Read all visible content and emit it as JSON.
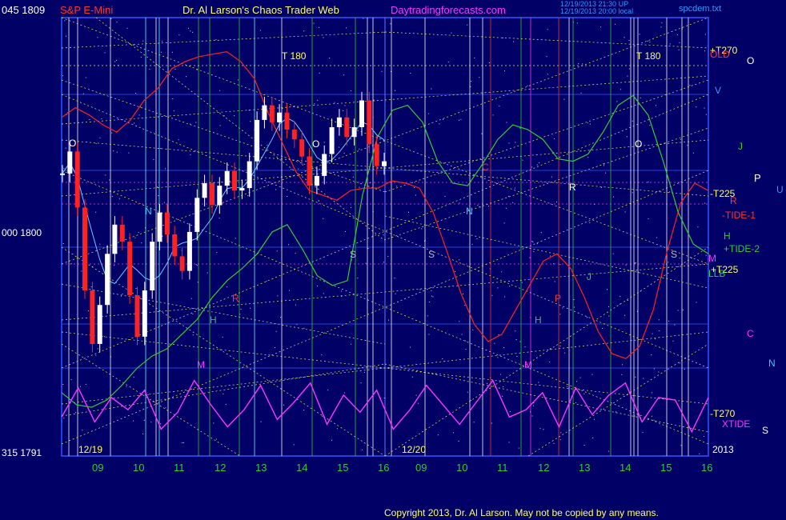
{
  "header": {
    "corner_values": "045  1809",
    "symbol": "S&P E-Mini",
    "title": "Dr. Al Larson's Chaos Trader Web",
    "website": "Daytradingforecasts.com",
    "timestamp_1": "12/19/2013 21:30 UP",
    "timestamp_2": "12/19/2013 20:00 local",
    "filename": "spcdem.txt"
  },
  "y_axis_labels": {
    "mid": "000  1800",
    "bottom": "315  1791"
  },
  "copyright": "Copyright 2013, Dr. Al Larson. May not be copied by any means.",
  "chart_data": {
    "type": "line",
    "title": "S&P E-Mini",
    "ylim": [
      1791,
      1809
    ],
    "x_ticks": [
      "09",
      "10",
      "11",
      "12",
      "13",
      "14",
      "15",
      "16",
      "09",
      "10",
      "11",
      "12",
      "13",
      "14",
      "15",
      "16"
    ],
    "date_labels": [
      "12/19",
      "12/20"
    ],
    "year_label": "2013",
    "price_series": {
      "name": "S&P E-Mini",
      "values": [
        1802.6,
        1803.5,
        1801.2,
        1797.8,
        1795.6,
        1797.2,
        1799.3,
        1800.5,
        1799.8,
        1797.6,
        1795.9,
        1797.8,
        1799.8,
        1801.0,
        1800.1,
        1799.2,
        1798.6,
        1800.2,
        1801.6,
        1802.2,
        1801.3,
        1802.1,
        1802.7,
        1801.9,
        1802.0,
        1803.1,
        1804.8,
        1805.4,
        1804.7,
        1805.1,
        1804.4,
        1804.0,
        1803.3,
        1802.1,
        1802.5,
        1803.4,
        1804.5,
        1804.9,
        1804.1,
        1804.5,
        1805.6,
        1803.8,
        1802.9,
        1803.1
      ]
    },
    "series": [
      {
        "name": "TIDE-1",
        "color": "#ff2020",
        "values": [
          1804.9,
          1805.3,
          1805.0,
          1804.6,
          1804.3,
          1804.8,
          1805.6,
          1806.1,
          1806.9,
          1807.2,
          1807.4,
          1807.5,
          1807.6,
          1807.2,
          1806.5,
          1805.1,
          1803.9,
          1802.7,
          1801.9,
          1801.7,
          1801.5,
          1801.9,
          1802.0,
          1802.0,
          1802.3,
          1802.2,
          1802.0,
          1801.0,
          1799.4,
          1797.7,
          1796.4,
          1795.7,
          1796.0,
          1797.0,
          1798.0,
          1799.0,
          1799.3,
          1798.7,
          1797.5,
          1796.1,
          1795.2,
          1795.0,
          1795.5,
          1797.0,
          1799.4,
          1801.4,
          1802.2,
          1801.9
        ]
      },
      {
        "name": "TIDE-2",
        "color": "#33cc33",
        "values": [
          1793.6,
          1793.1,
          1793.0,
          1793.3,
          1793.9,
          1794.6,
          1795.1,
          1795.4,
          1796.0,
          1796.6,
          1797.5,
          1798.2,
          1798.7,
          1799.3,
          1800.2,
          1800.5,
          1799.5,
          1798.4,
          1798.0,
          1798.2,
          1801.7,
          1804.1,
          1805.2,
          1805.4,
          1804.7,
          1803.1,
          1802.2,
          1802.1,
          1803.0,
          1804.0,
          1804.6,
          1804.4,
          1804.0,
          1803.2,
          1803.1,
          1803.4,
          1804.3,
          1805.4,
          1805.8,
          1805.0,
          1803.1,
          1801.0,
          1799.7,
          1799.3
        ]
      },
      {
        "name": "XTIDE",
        "color": "#ff33ff",
        "values": [
          1792.6,
          1793.8,
          1792.4,
          1793.4,
          1792.9,
          1793.7,
          1792.1,
          1792.8,
          1794.1,
          1793.1,
          1792.2,
          1792.9,
          1793.9,
          1792.5,
          1793.2,
          1794.0,
          1792.3,
          1793.5,
          1792.8,
          1793.7,
          1792.1,
          1792.9,
          1793.9,
          1793.1,
          1792.3,
          1793.2,
          1794.1,
          1792.6,
          1792.9,
          1793.6,
          1792.2,
          1793.8,
          1792.7,
          1793.5,
          1794.0,
          1792.4,
          1793.4,
          1793.3,
          1792.0,
          1793.4
        ]
      }
    ],
    "right_labels": [
      {
        "text": "+T270",
        "color": "#ffff66"
      },
      {
        "text": "OLD",
        "color": "#ff3333"
      },
      {
        "text": "O",
        "color": "#ffffff"
      },
      {
        "text": "V",
        "color": "#3399ff"
      },
      {
        "text": "J",
        "color": "#33cc33"
      },
      {
        "text": "P",
        "color": "#ffffff"
      },
      {
        "text": "U",
        "color": "#3399ff"
      },
      {
        "text": "-T225",
        "color": "#ffff66"
      },
      {
        "text": "R",
        "color": "#ff3333"
      },
      {
        "text": "-TIDE-1",
        "color": "#ff3333"
      },
      {
        "text": "H",
        "color": "#33cc33"
      },
      {
        "text": "+TIDE-2",
        "color": "#33cc33"
      },
      {
        "text": "M",
        "color": "#ff33ff"
      },
      {
        "text": "+T225",
        "color": "#ffff66"
      },
      {
        "text": "LLB",
        "color": "#33cc33"
      },
      {
        "text": "C",
        "color": "#ff33ff"
      },
      {
        "text": "N",
        "color": "#33ccff"
      },
      {
        "text": "-T270",
        "color": "#ffff66"
      },
      {
        "text": "XTIDE",
        "color": "#ff33ff"
      },
      {
        "text": "S",
        "color": "#ffffff"
      }
    ],
    "inline_labels": [
      {
        "text": "T  180",
        "color": "#ffff66"
      },
      {
        "text": "T  180",
        "color": "#ffff66"
      },
      {
        "text": "O",
        "color": "#ffffff"
      },
      {
        "text": "O",
        "color": "#ffffff"
      },
      {
        "text": "O",
        "color": "#ffffff"
      },
      {
        "text": "N",
        "color": "#33ccff"
      },
      {
        "text": "N",
        "color": "#33ccff"
      },
      {
        "text": "R",
        "color": "#ff3333"
      },
      {
        "text": "R",
        "color": "#ffffff"
      },
      {
        "text": "C",
        "color": "#ff3333"
      },
      {
        "text": "H",
        "color": "#33cc33"
      },
      {
        "text": "H",
        "color": "#33cc33"
      },
      {
        "text": "M",
        "color": "#ff33ff"
      },
      {
        "text": "M",
        "color": "#ff33ff"
      },
      {
        "text": "S",
        "color": "#bbbbbb"
      },
      {
        "text": "S",
        "color": "#bbbbbb"
      },
      {
        "text": "S",
        "color": "#bbbbbb"
      },
      {
        "text": "J",
        "color": "#33cc33"
      },
      {
        "text": "P",
        "color": "#ff3333"
      }
    ],
    "vertical_line_colors": {
      "white": "#ffffff",
      "cyan": "#66ffff",
      "green": "#33cc33",
      "red": "#ff3333",
      "magenta": "#ff33ff"
    },
    "grid": "on"
  }
}
